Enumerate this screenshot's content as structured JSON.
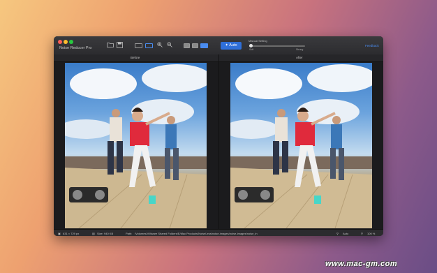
{
  "window": {
    "title": "Noise Reducer Pro",
    "traffic_lights": {
      "close": "#fc5f57",
      "minimize": "#fdbc2e",
      "zoom": "#28c840"
    }
  },
  "toolbar": {
    "folder_icon": "folder-icon",
    "save_icon": "save-icon",
    "zoom_in_icon": "zoom-in-icon",
    "zoom_out_icon": "zoom-out-icon",
    "auto_label": "Auto",
    "auto_icon": "wand-icon",
    "manual_setting_label": "Manual Setting",
    "slider_min_label": "Soft",
    "slider_max_label": "Strong",
    "feedback_label": "Feedback",
    "accent_color": "#2f6fd8"
  },
  "panes": {
    "before_label": "Before",
    "after_label": "After"
  },
  "status": {
    "dimensions": "631 × 729 px",
    "size": "Size: 940 KB",
    "path_label": "Path:",
    "path": "/Volumes/VMware Shared Folders/E/Mac Products/NoiseLess/noise-images/noise-images/noise_in",
    "auto_label": "Auto",
    "zoom": "100 %"
  },
  "watermark": "www.mac-gm.com"
}
